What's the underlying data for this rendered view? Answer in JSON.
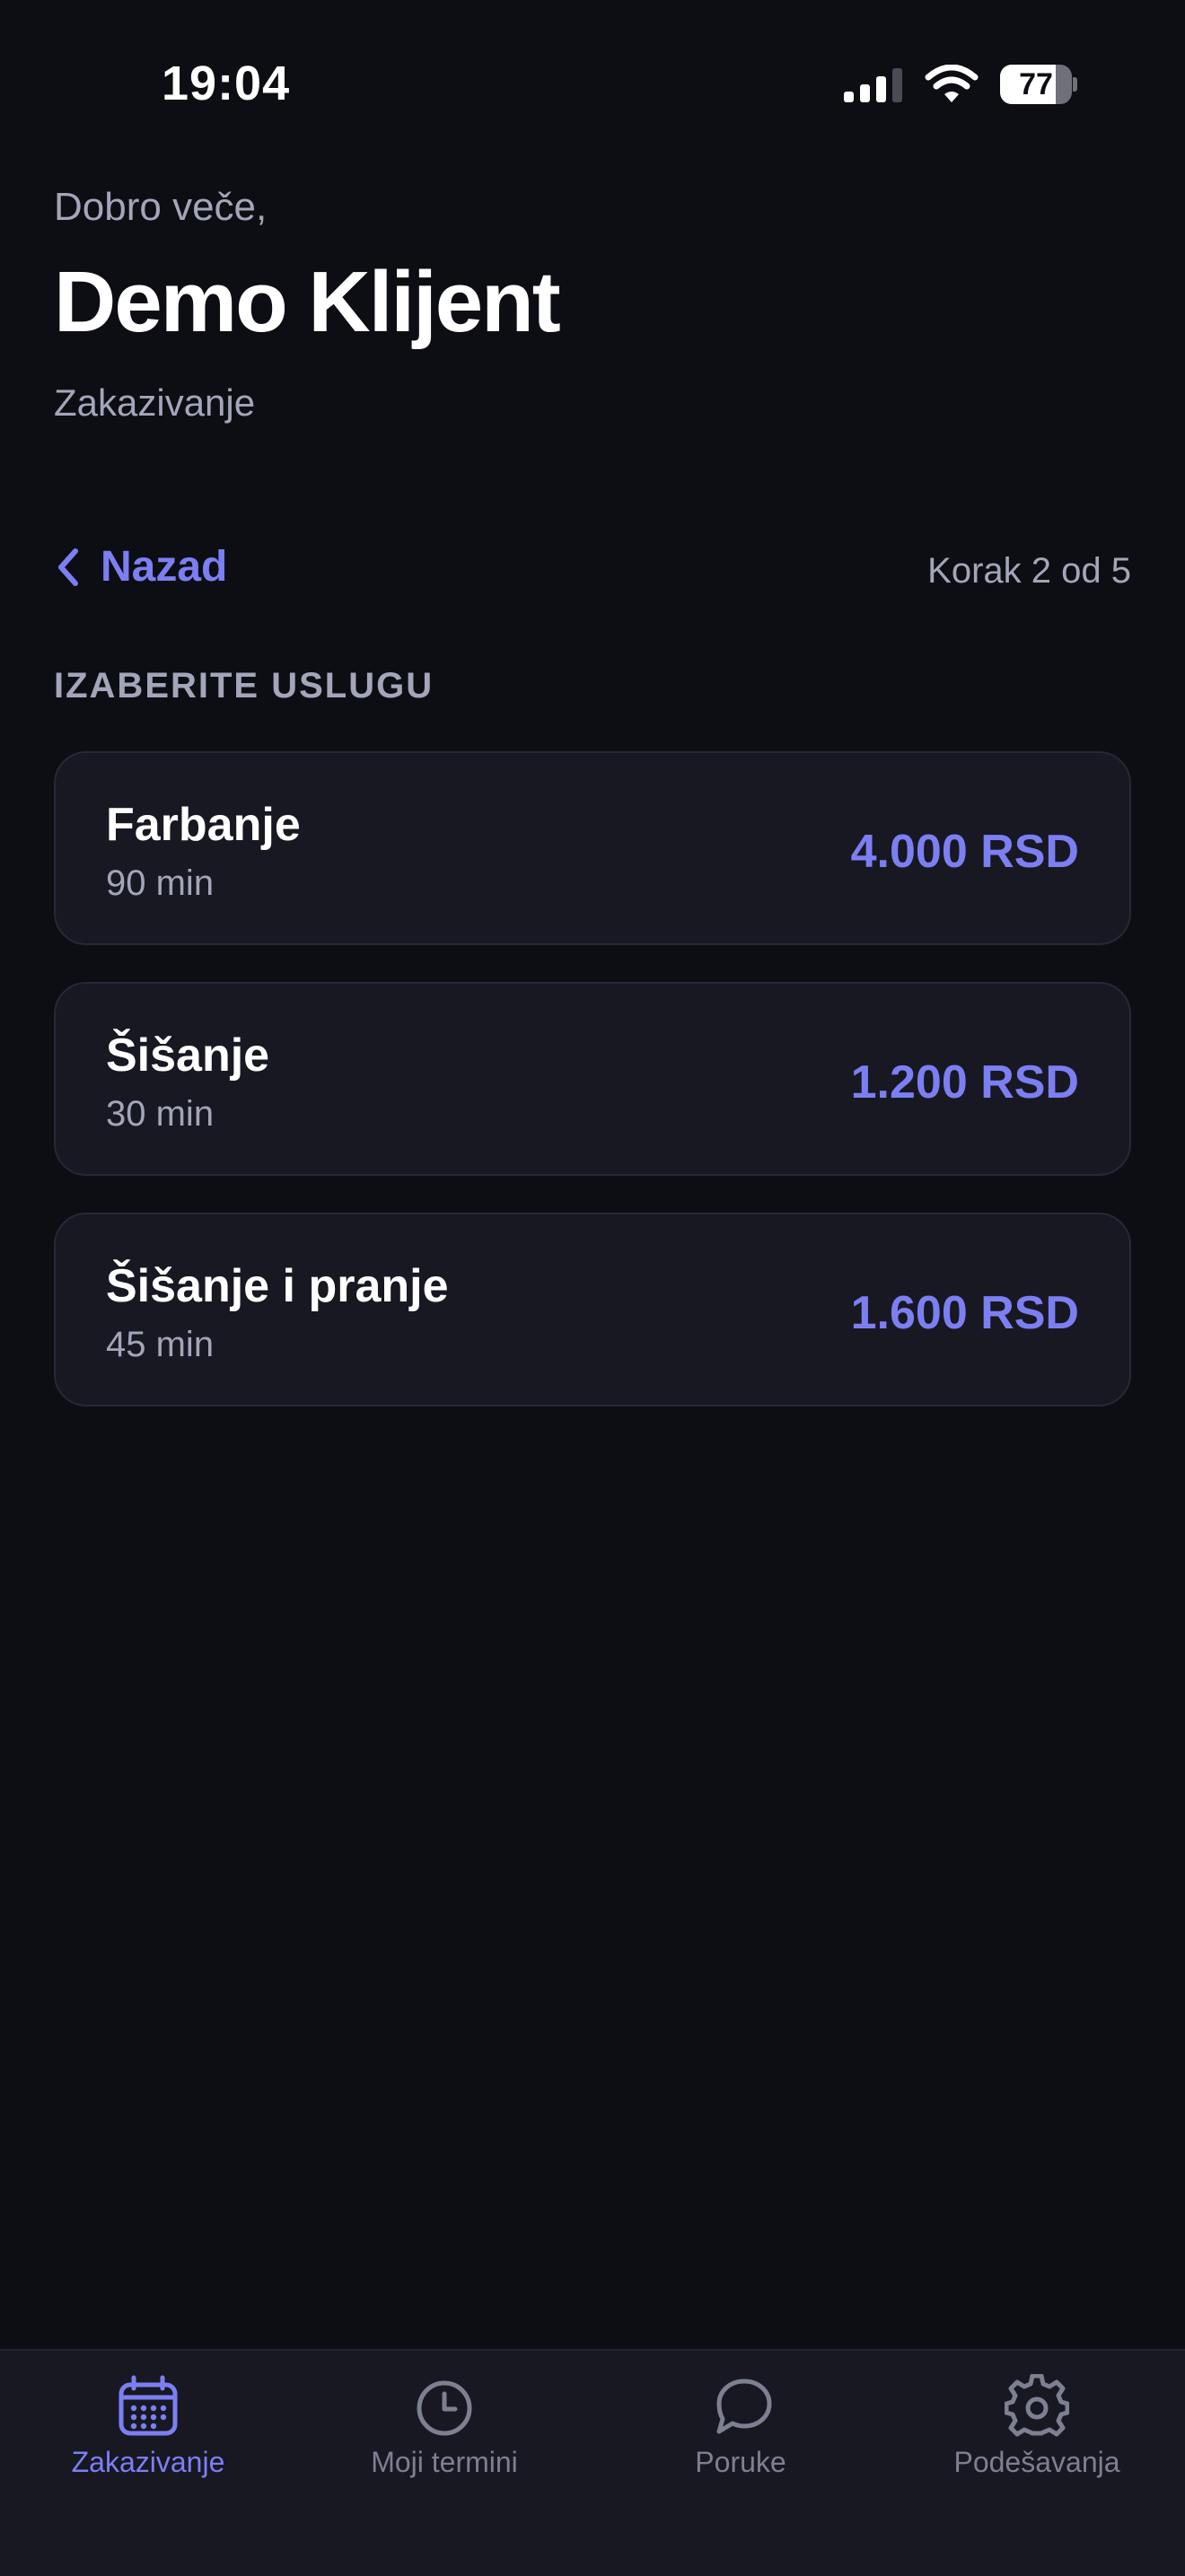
{
  "status_bar": {
    "time": "19:04",
    "battery_level": "77",
    "battery_fraction": 0.77
  },
  "header": {
    "greeting": "Dobro veče,",
    "user_name": "Demo Klijent",
    "subtitle": "Zakazivanje"
  },
  "navigation": {
    "back_label": "Nazad",
    "step_label": "Korak 2 od 5"
  },
  "section": {
    "title": "IZABERITE USLUGU"
  },
  "services": [
    {
      "name": "Farbanje",
      "duration": "90 min",
      "price": "4.000 RSD"
    },
    {
      "name": "Šišanje",
      "duration": "30 min",
      "price": "1.200 RSD"
    },
    {
      "name": "Šišanje i pranje",
      "duration": "45 min",
      "price": "1.600 RSD"
    }
  ],
  "tab_bar": {
    "tabs": [
      {
        "label": "Zakazivanje",
        "icon": "calendar-icon",
        "active": true
      },
      {
        "label": "Moji termini",
        "icon": "clock-icon",
        "active": false
      },
      {
        "label": "Poruke",
        "icon": "chat-bubble-icon",
        "active": false
      },
      {
        "label": "Podešavanja",
        "icon": "gear-icon",
        "active": false
      }
    ]
  },
  "colors": {
    "background": "#0d0e14",
    "card": "#171822",
    "accent": "#7c7ff2",
    "muted_text": "#a3a6b8",
    "inactive_tab": "#7d8091"
  }
}
